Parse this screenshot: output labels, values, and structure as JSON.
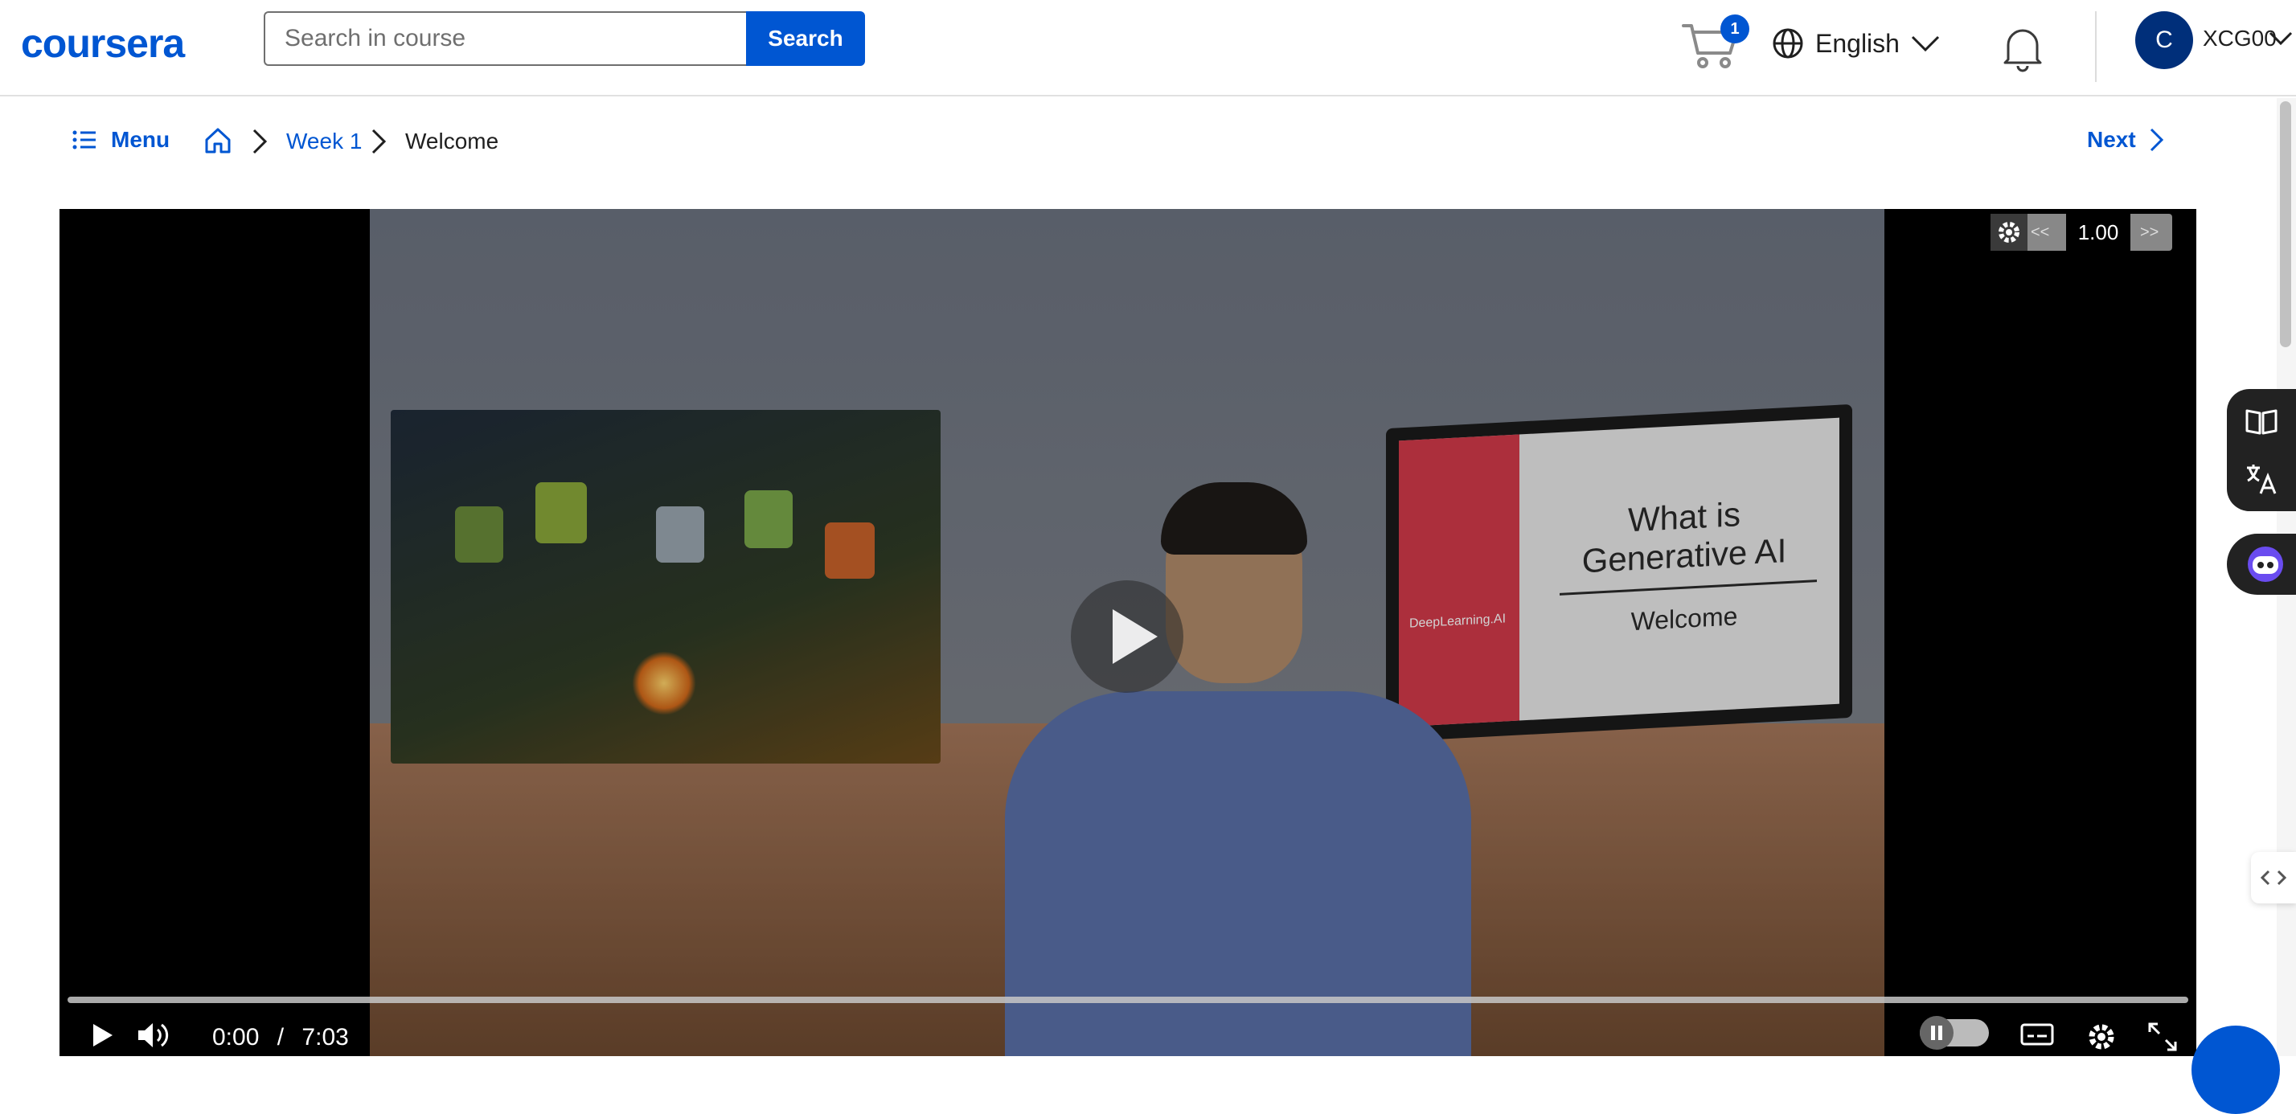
{
  "header": {
    "logo": "coursera",
    "search_placeholder": "Search in course",
    "search_button": "Search",
    "cart_count": "1",
    "language": "English",
    "avatar_initial": "C",
    "username": "XCG00",
    "accent_color": "#0056d2"
  },
  "breadcrumb": {
    "menu_label": "Menu",
    "week": "Week 1",
    "current": "Welcome",
    "next_label": "Next"
  },
  "video": {
    "speed": "1.00",
    "speed_decrease": "<<",
    "speed_increase": ">>",
    "current_time": "0:00",
    "time_separator": "/",
    "duration": "7:03",
    "progress": 0,
    "slide_title_line1": "What is",
    "slide_title_line2": "Generative AI",
    "slide_subtitle": "Welcome",
    "slide_brand": "DeepLearning.AI"
  },
  "icons": {
    "menu": "list-icon",
    "home": "home-icon",
    "cart": "cart-icon",
    "language": "globe-icon",
    "notifications": "bell-icon",
    "play": "play-icon",
    "volume": "volume-icon",
    "captions": "captions-icon",
    "settings": "gear-icon",
    "fullscreen": "fullscreen-icon"
  }
}
